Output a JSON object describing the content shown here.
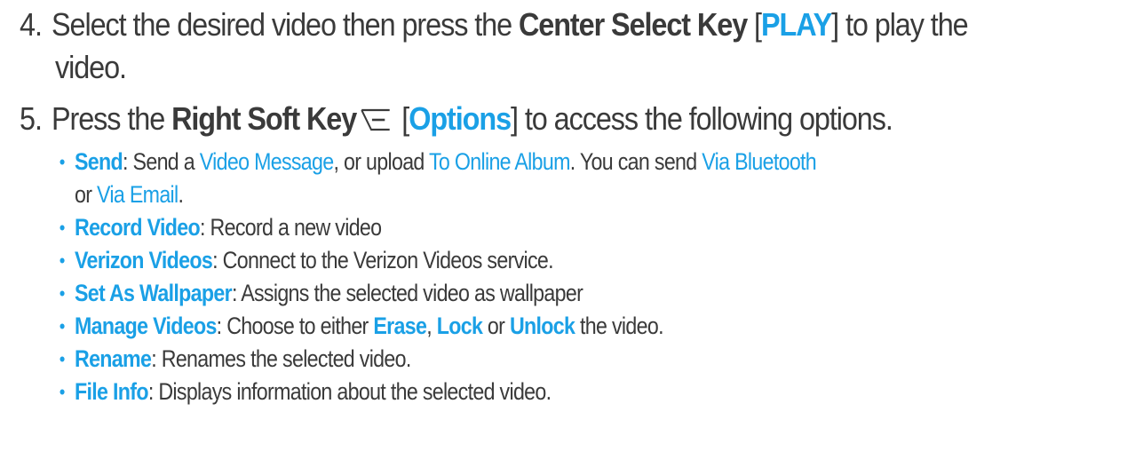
{
  "step4": {
    "number": "4.",
    "text_a": "Select the desired video then press the ",
    "key": "Center Select Key",
    "open_bracket": " [",
    "key_label": "PLAY",
    "close_bracket": "]",
    "text_b": " to play the",
    "text_c": "video."
  },
  "step5": {
    "number": "5.",
    "text_a": "Press the ",
    "key": "Right Soft Key",
    "open_bracket": " [",
    "key_label": "Options",
    "close_bracket": "]",
    "text_b": " to access the following options.",
    "icon": "right-soft-key-icon"
  },
  "options": [
    {
      "label": "Send",
      "sep": ": ",
      "line1": [
        {
          "t": "Send a ",
          "accent": false
        },
        {
          "t": "Video Message",
          "accent": true
        },
        {
          "t": ", or upload ",
          "accent": false
        },
        {
          "t": "To Online Album",
          "accent": true
        },
        {
          "t": ". You can send ",
          "accent": false
        },
        {
          "t": "Via Bluetooth",
          "accent": true
        }
      ],
      "line2": [
        {
          "t": "or ",
          "accent": false
        },
        {
          "t": "Via Email",
          "accent": true
        },
        {
          "t": ".",
          "accent": false
        }
      ]
    },
    {
      "label": "Record Video",
      "sep": ": ",
      "desc": "Record a new video"
    },
    {
      "label": "Verizon Videos",
      "sep": ": ",
      "desc": "Connect to the Verizon Videos service."
    },
    {
      "label": "Set As Wallpaper",
      "sep": ": ",
      "desc": "Assigns the selected video as wallpaper"
    },
    {
      "label": "Manage Videos",
      "sep": ": ",
      "desc_a": "Choose to either ",
      "erase": "Erase",
      "comma": ", ",
      "lock": "Lock",
      "or": " or ",
      "unlock": "Unlock",
      "desc_b": " the video."
    },
    {
      "label": "Rename",
      "sep": ": ",
      "desc": "Renames the selected video."
    },
    {
      "label": "File Info",
      "sep": ": ",
      "desc": "Displays information about the selected video."
    }
  ],
  "bullet_char": "•",
  "colors": {
    "accent": "#1aa0e6",
    "text": "#3a3a3a"
  }
}
